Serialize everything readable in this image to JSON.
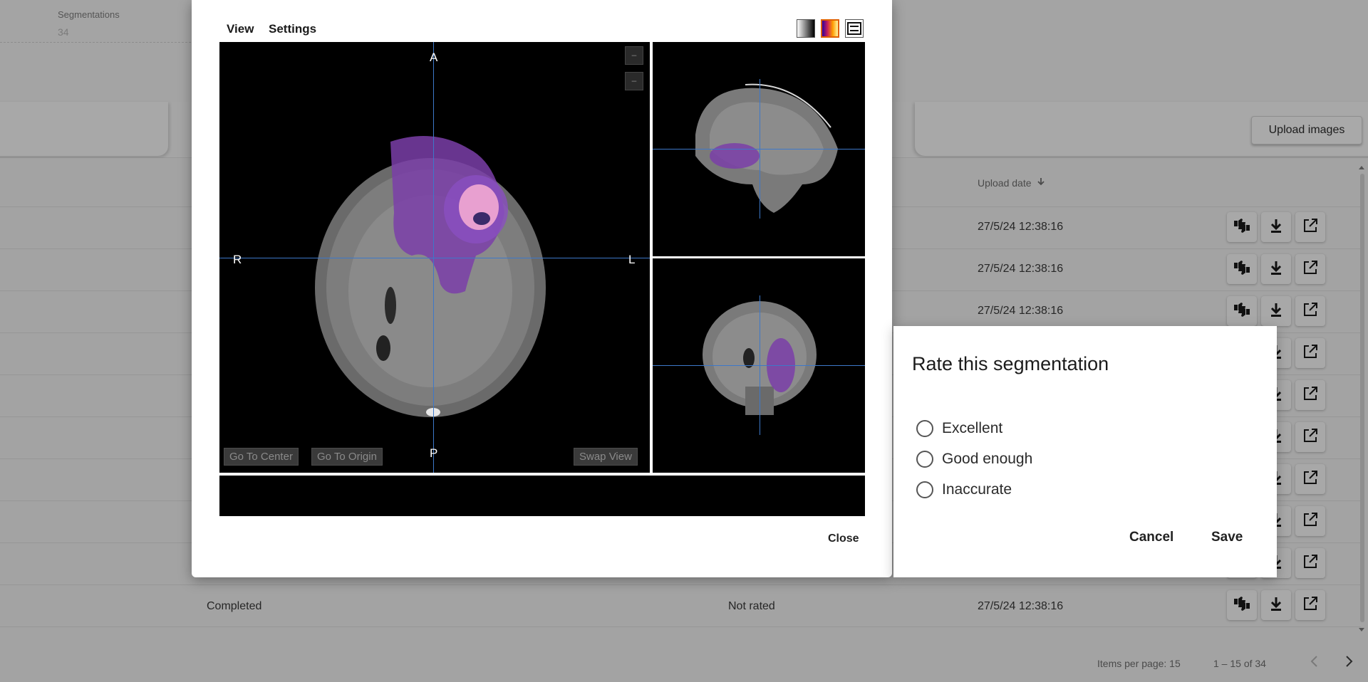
{
  "background": {
    "stat_label": "Segmentations",
    "stat_value": "34",
    "upload_label": "Upload images",
    "column_header": "Upload date",
    "rows": [
      {
        "date": "27/5/24 12:38:16"
      },
      {
        "date": "27/5/24 12:38:16"
      },
      {
        "date": "27/5/24 12:38:16"
      }
    ],
    "last_row": {
      "status": "Completed",
      "rating": "Not rated",
      "date": "27/5/24 12:38:16"
    },
    "paginator": {
      "items_per_page_label": "Items per page:",
      "items_per_page": "15",
      "range": "1 – 15 of 34"
    }
  },
  "viewer": {
    "menu": {
      "view": "View",
      "settings": "Settings"
    },
    "tools": [
      "grayscale-colormap-icon",
      "hot-colormap-icon",
      "swap-layout-icon"
    ],
    "orientation": {
      "anterior": "A",
      "posterior": "P",
      "right": "R",
      "left": "L"
    },
    "buttons": {
      "go_to_center": "Go To Center",
      "go_to_origin": "Go To Origin",
      "swap_view": "Swap View"
    },
    "zoom": {
      "minus1": "–",
      "minus2": "–"
    },
    "close_label": "Close"
  },
  "rating_dialog": {
    "title": "Rate this segmentation",
    "options": [
      "Excellent",
      "Good enough",
      "Inaccurate"
    ],
    "cancel": "Cancel",
    "save": "Save"
  },
  "colors": {
    "crosshair": "#3d78c9",
    "overlay": "#8a3fb0",
    "tumor_core": "#f0a8d8",
    "dim_background": "#a3a3a3"
  }
}
